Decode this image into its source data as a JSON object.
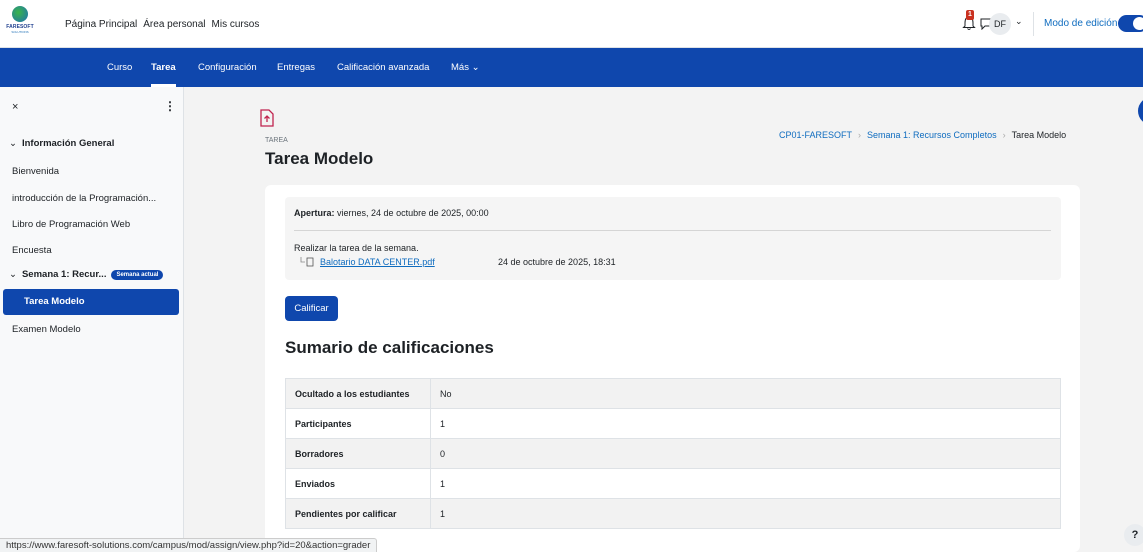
{
  "brand": {
    "name": "FARESOFT",
    "sub": "SOLUTIONS"
  },
  "topnav": {
    "home": "Página Principal",
    "personal": "Área personal",
    "courses": "Mis cursos"
  },
  "header": {
    "notif_count": "1",
    "avatar_initials": "DF",
    "edit_mode_label": "Modo de edición"
  },
  "secnav": [
    "Curso",
    "Tarea",
    "Configuración",
    "Entregas",
    "Calificación avanzada",
    "Más"
  ],
  "drawer": {
    "close": "×",
    "more": "⋮",
    "section1": "Información General",
    "items1": [
      "Bienvenida",
      "introducción de la Programación...",
      "Libro de Programación Web",
      "Encuesta"
    ],
    "section2": "Semana 1: Recur...",
    "section2_badge": "Semana actual",
    "items2": [
      "Tarea Modelo",
      "Examen Modelo"
    ]
  },
  "page": {
    "activity_type": "TAREA",
    "title": "Tarea Modelo",
    "breadcrumb": [
      "CP01-FARESOFT",
      "Semana 1: Recursos Completos",
      "Tarea Modelo"
    ]
  },
  "info": {
    "open_label": "Apertura:",
    "open_value": "viernes, 24 de octubre de 2025, 00:00",
    "description": "Realizar la tarea de la semana.",
    "file_name": "Balotario DATA CENTER.pdf",
    "file_date": "24 de octubre de 2025, 18:31"
  },
  "grade_button": "Calificar",
  "summary": {
    "title": "Sumario de calificaciones",
    "rows": [
      {
        "k": "Ocultado a los estudiantes",
        "v": "No"
      },
      {
        "k": "Participantes",
        "v": "1"
      },
      {
        "k": "Borradores",
        "v": "0"
      },
      {
        "k": "Enviados",
        "v": "1"
      },
      {
        "k": "Pendientes por calificar",
        "v": "1"
      }
    ]
  },
  "help": "?",
  "status_url": "https://www.faresoft-solutions.com/campus/mod/assign/view.php?id=20&action=grader",
  "colors": {
    "primary": "#0f47ad",
    "link": "#0f6cbf",
    "badge": "#ca3120"
  }
}
